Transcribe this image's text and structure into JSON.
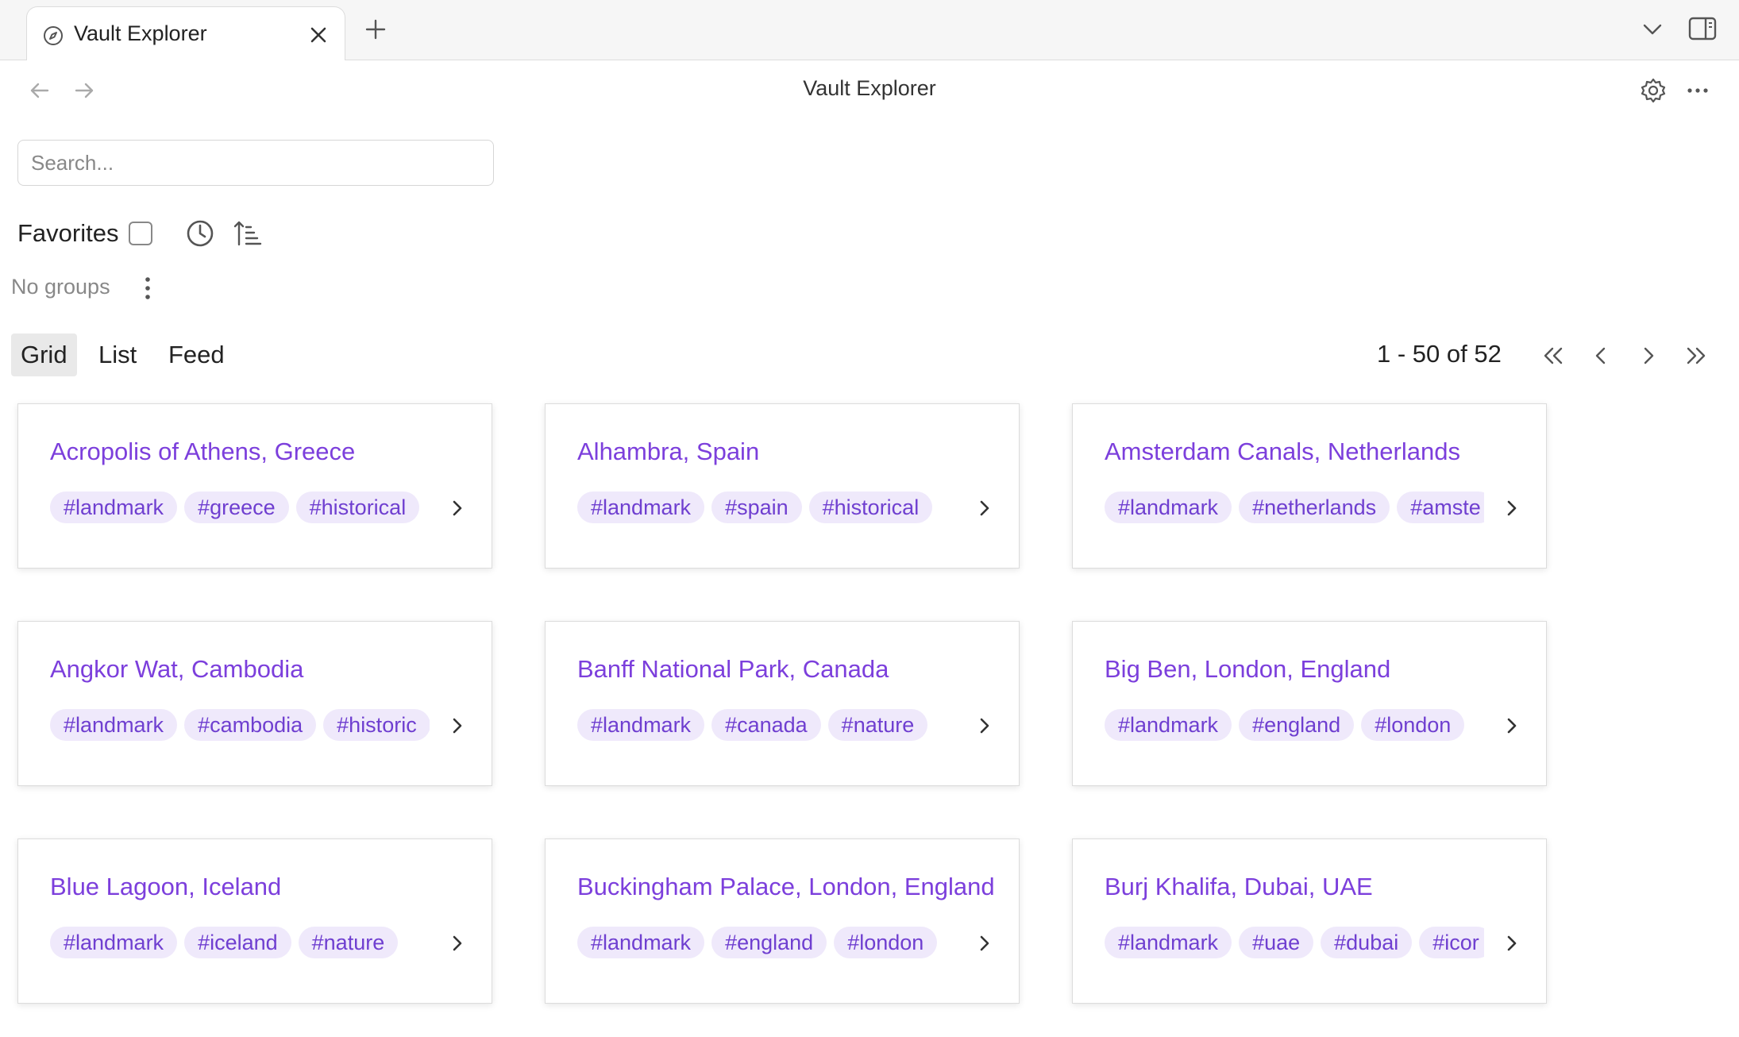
{
  "tab": {
    "title": "Vault Explorer",
    "icon": "compass-icon"
  },
  "header": {
    "title": "Vault Explorer"
  },
  "search": {
    "placeholder": "Search...",
    "value": ""
  },
  "filters": {
    "favorites_label": "Favorites",
    "favorites_checked": false,
    "no_groups_label": "No groups"
  },
  "views": {
    "items": [
      {
        "label": "Grid",
        "active": true
      },
      {
        "label": "List",
        "active": false
      },
      {
        "label": "Feed",
        "active": false
      }
    ]
  },
  "pagination": {
    "text": "1 - 50 of 52"
  },
  "colors": {
    "accent": "#7c3fdc",
    "tag_bg": "#efe9fb",
    "tag_text": "#6f3fd0"
  },
  "cards": [
    {
      "title": "Acropolis of Athens, Greece",
      "tags": [
        "#landmark",
        "#greece",
        "#historical"
      ]
    },
    {
      "title": "Alhambra, Spain",
      "tags": [
        "#landmark",
        "#spain",
        "#historical"
      ]
    },
    {
      "title": "Amsterdam Canals, Netherlands",
      "tags": [
        "#landmark",
        "#netherlands",
        "#amste"
      ]
    },
    {
      "title": "Angkor Wat, Cambodia",
      "tags": [
        "#landmark",
        "#cambodia",
        "#historic"
      ]
    },
    {
      "title": "Banff National Park, Canada",
      "tags": [
        "#landmark",
        "#canada",
        "#nature"
      ]
    },
    {
      "title": "Big Ben, London, England",
      "tags": [
        "#landmark",
        "#england",
        "#london"
      ]
    },
    {
      "title": "Blue Lagoon, Iceland",
      "tags": [
        "#landmark",
        "#iceland",
        "#nature"
      ]
    },
    {
      "title": "Buckingham Palace, London, England",
      "tags": [
        "#landmark",
        "#england",
        "#london"
      ]
    },
    {
      "title": "Burj Khalifa, Dubai, UAE",
      "tags": [
        "#landmark",
        "#uae",
        "#dubai",
        "#icor"
      ]
    }
  ]
}
